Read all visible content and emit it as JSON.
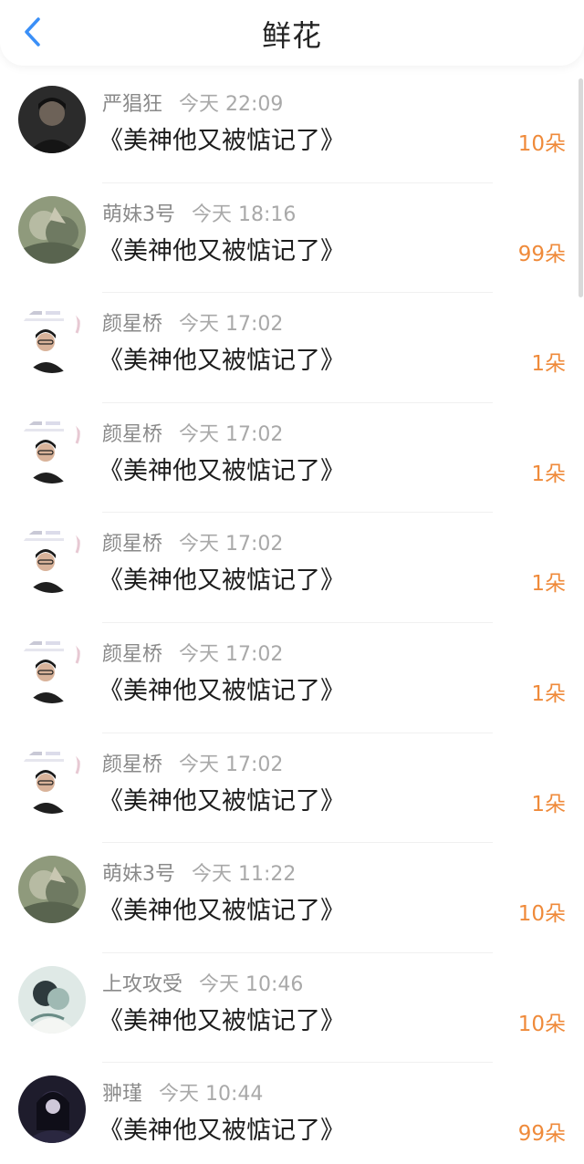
{
  "header": {
    "title": "鲜花",
    "back_icon": "chevron-left-icon",
    "accent": "#3a8ff7"
  },
  "colors": {
    "count": "#ef8a3a"
  },
  "items": [
    {
      "name": "严猖狂",
      "time": "今天 22:09",
      "book": "《美神他又被惦记了》",
      "count": "10朵",
      "avatar": "photo-dark"
    },
    {
      "name": "萌妹3号",
      "time": "今天 18:16",
      "book": "《美神他又被惦记了》",
      "count": "99朵",
      "avatar": "illustration-green"
    },
    {
      "name": "颜星桥",
      "time": "今天 17:02",
      "book": "《美神他又被惦记了》",
      "count": "1朵",
      "avatar": "photo-boy"
    },
    {
      "name": "颜星桥",
      "time": "今天 17:02",
      "book": "《美神他又被惦记了》",
      "count": "1朵",
      "avatar": "photo-boy"
    },
    {
      "name": "颜星桥",
      "time": "今天 17:02",
      "book": "《美神他又被惦记了》",
      "count": "1朵",
      "avatar": "photo-boy"
    },
    {
      "name": "颜星桥",
      "time": "今天 17:02",
      "book": "《美神他又被惦记了》",
      "count": "1朵",
      "avatar": "photo-boy"
    },
    {
      "name": "颜星桥",
      "time": "今天 17:02",
      "book": "《美神他又被惦记了》",
      "count": "1朵",
      "avatar": "photo-boy"
    },
    {
      "name": "萌妹3号",
      "time": "今天 11:22",
      "book": "《美神他又被惦记了》",
      "count": "10朵",
      "avatar": "illustration-green"
    },
    {
      "name": "上攻攻受",
      "time": "今天 10:46",
      "book": "《美神他又被惦记了》",
      "count": "10朵",
      "avatar": "illustration-light"
    },
    {
      "name": "翀瑾",
      "time": "今天 10:44",
      "book": "《美神他又被惦记了》",
      "count": "99朵",
      "avatar": "illustration-dark"
    }
  ]
}
